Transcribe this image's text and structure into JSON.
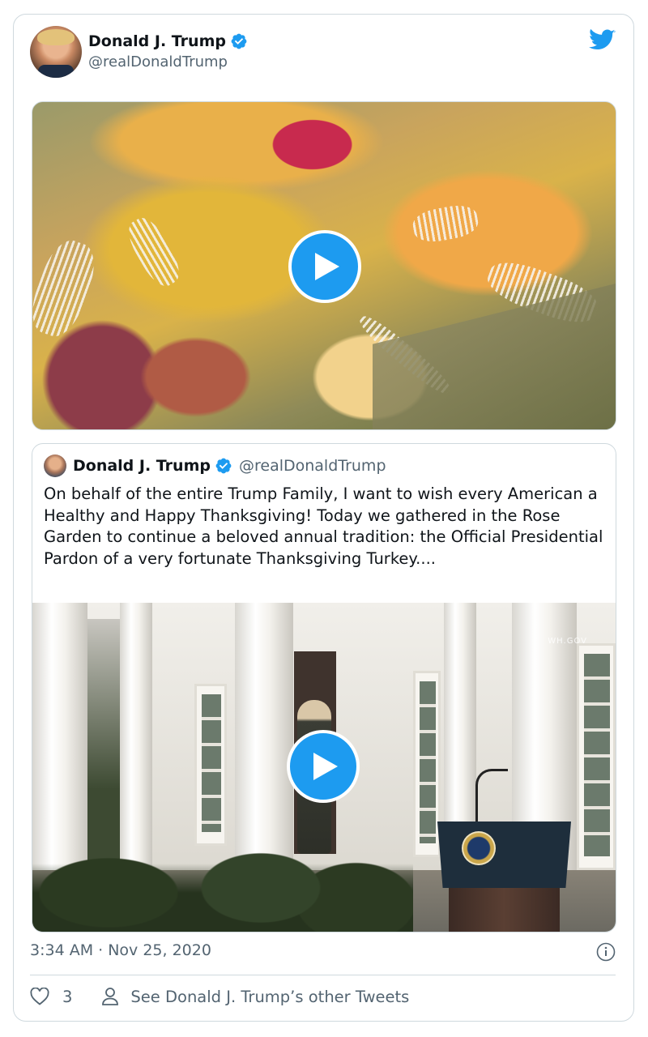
{
  "tweet": {
    "author_name": "Donald J. Trump",
    "author_handle": "@realDonaldTrump",
    "timestamp": "3:34 AM · Nov 25, 2020",
    "like_count": "3",
    "other_tweets_label": "See Donald J. Trump’s other Tweets"
  },
  "quoted": {
    "author_name": "Donald J. Trump",
    "author_handle": "@realDonaldTrump",
    "text": "On behalf of the entire Trump Family, I want to wish every American a Healthy and Happy Thanksgiving! Today we gathered in the Rose Garden to continue a beloved annual tradition: the Official Presidential Pardon of a very fortunate Thanksgiving Turkey....",
    "watermark": "WH.GOV"
  },
  "colors": {
    "accent": "#1d9bf0",
    "text": "#0f1419",
    "muted": "#536471",
    "border": "#cfd9de"
  },
  "icons": [
    "twitter-bird-icon",
    "verified-badge-icon",
    "play-icon",
    "info-icon",
    "heart-icon",
    "person-icon"
  ]
}
